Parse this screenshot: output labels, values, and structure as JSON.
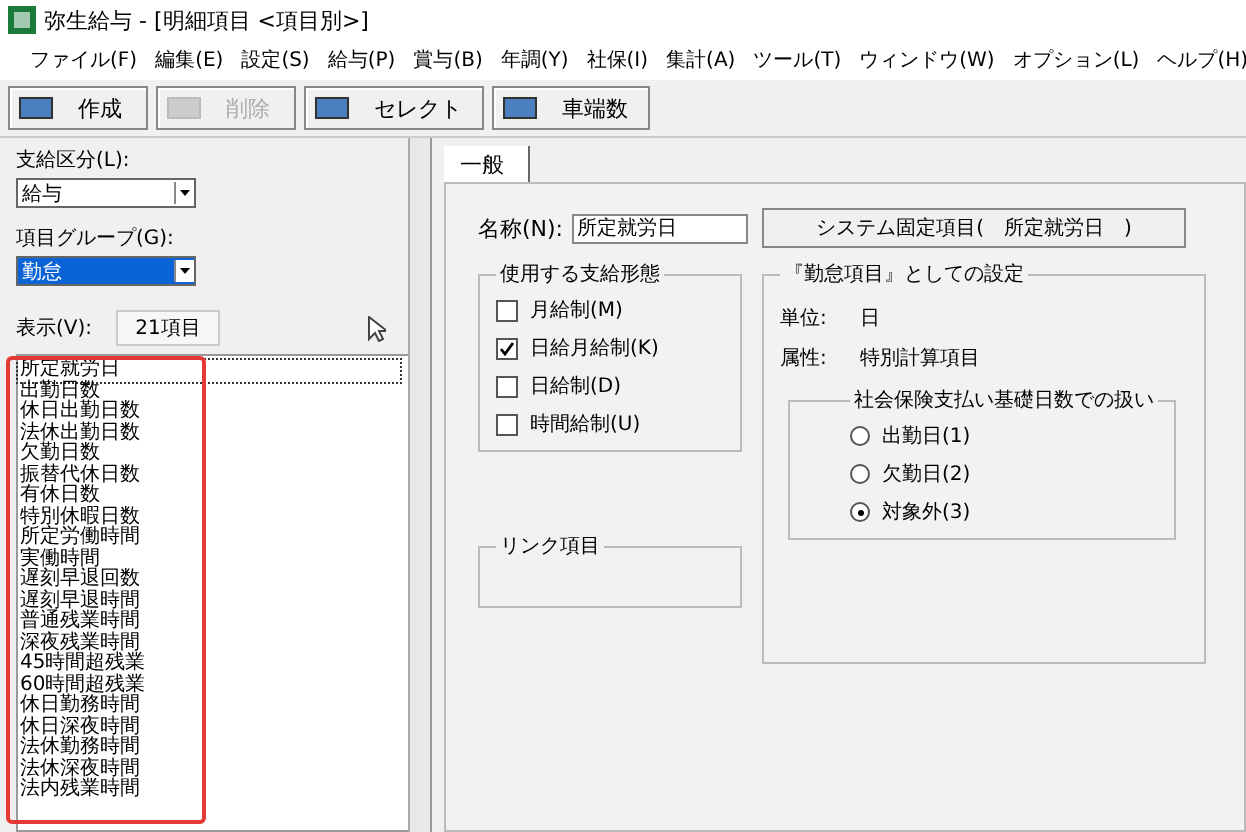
{
  "window": {
    "title": "弥生給与 - [明細項目 <項目別>]"
  },
  "menu": [
    "ファイル(F)",
    "編集(E)",
    "設定(S)",
    "給与(P)",
    "賞与(B)",
    "年調(Y)",
    "社保(I)",
    "集計(A)",
    "ツール(T)",
    "ウィンドウ(W)",
    "オプション(L)",
    "ヘルプ(H)"
  ],
  "toolbar": [
    {
      "label": "作成",
      "disabled": false
    },
    {
      "label": "削除",
      "disabled": true
    },
    {
      "label": "セレクト",
      "disabled": false
    },
    {
      "label": "車端数",
      "disabled": false
    }
  ],
  "left": {
    "pay_type_label": "支給区分(L):",
    "pay_type_value": "給与",
    "group_label": "項目グループ(G):",
    "group_value": "勤怠",
    "display_label": "表示(V):",
    "display_count": "21項目",
    "items": [
      {
        "label": "所定就労日",
        "selected": true
      },
      {
        "label": "出勤日数",
        "selected": false
      },
      {
        "label": "休日出勤日数",
        "selected": false
      },
      {
        "label": "法休出勤日数",
        "selected": false
      },
      {
        "label": "欠勤日数",
        "selected": false
      },
      {
        "label": "振替代休日数",
        "selected": false
      },
      {
        "label": "有休日数",
        "selected": false
      },
      {
        "label": "特別休暇日数",
        "selected": false
      },
      {
        "label": "所定労働時間",
        "selected": false
      },
      {
        "label": "実働時間",
        "selected": false
      },
      {
        "label": "遅刻早退回数",
        "selected": false
      },
      {
        "label": "遅刻早退時間",
        "selected": false
      },
      {
        "label": "普通残業時間",
        "selected": false
      },
      {
        "label": "深夜残業時間",
        "selected": false
      },
      {
        "label": "45時間超残業",
        "selected": false
      },
      {
        "label": "60時間超残業",
        "selected": false
      },
      {
        "label": "休日勤務時間",
        "selected": false
      },
      {
        "label": "休日深夜時間",
        "selected": false
      },
      {
        "label": "法休勤務時間",
        "selected": false
      },
      {
        "label": "法休深夜時間",
        "selected": false
      },
      {
        "label": "法内残業時間",
        "selected": false
      }
    ]
  },
  "tabs": [
    {
      "label": "一般",
      "selected": true
    }
  ],
  "form": {
    "name_label": "名称(N):",
    "name_value": "所定就労日",
    "system_button": "システム固定項目(　所定就労日　)",
    "pay_forms": {
      "title": "使用する支給形態",
      "options": [
        {
          "label": "月給制(M)",
          "checked": false
        },
        {
          "label": "日給月給制(K)",
          "checked": true
        },
        {
          "label": "日給制(D)",
          "checked": false
        },
        {
          "label": "時間給制(U)",
          "checked": false
        }
      ]
    },
    "link": {
      "title": "リンク項目"
    },
    "attendance": {
      "title": "『勤怠項目』としての設定",
      "unit_label": "単位:",
      "unit_value": "日",
      "attr_label": "属性:",
      "attr_value": "特別計算項目",
      "social": {
        "title": "社会保険支払い基礎日数での扱い",
        "options": [
          {
            "label": "出勤日(1)",
            "selected": false
          },
          {
            "label": "欠勤日(2)",
            "selected": false
          },
          {
            "label": "対象外(3)",
            "selected": true
          }
        ]
      }
    }
  }
}
